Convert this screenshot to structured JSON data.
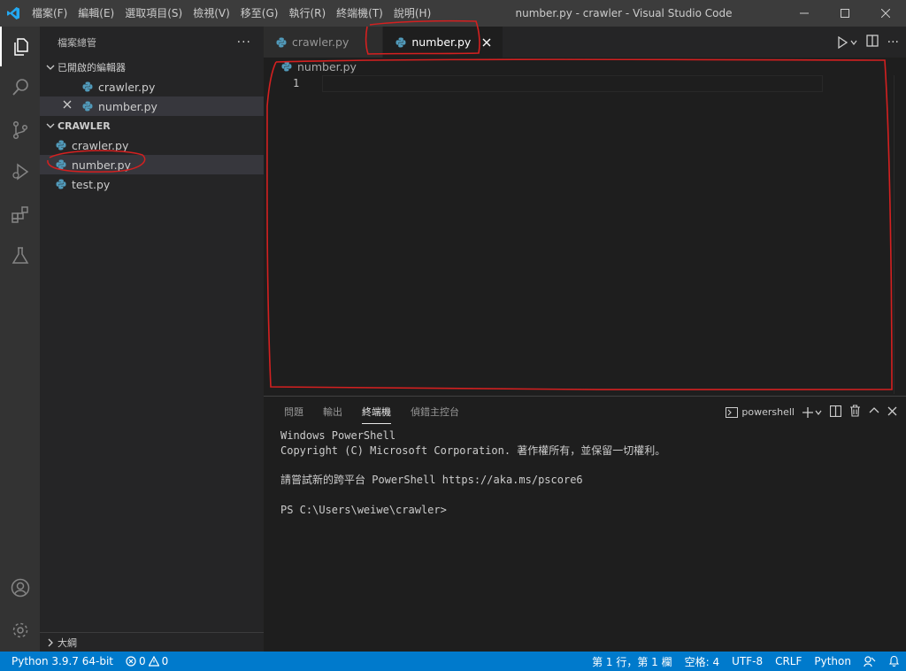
{
  "window": {
    "title": "number.py - crawler - Visual Studio Code"
  },
  "menu": [
    "檔案(F)",
    "編輯(E)",
    "選取項目(S)",
    "檢視(V)",
    "移至(G)",
    "執行(R)",
    "終端機(T)",
    "說明(H)"
  ],
  "sidebar": {
    "title": "檔案總管",
    "open_editors": {
      "header": "已開啟的編輯器",
      "items": [
        {
          "label": "crawler.py"
        },
        {
          "label": "number.py"
        }
      ]
    },
    "folder": {
      "header": "CRAWLER",
      "items": [
        {
          "label": "crawler.py"
        },
        {
          "label": "number.py"
        },
        {
          "label": "test.py"
        }
      ]
    },
    "outline": "大綱"
  },
  "tabs": [
    {
      "label": "crawler.py",
      "active": false
    },
    {
      "label": "number.py",
      "active": true
    }
  ],
  "breadcrumb": "number.py",
  "editor": {
    "line_numbers": [
      "1"
    ]
  },
  "panel": {
    "tabs": [
      "問題",
      "輸出",
      "終端機",
      "偵錯主控台"
    ],
    "active_tab": "終端機",
    "shell": "powershell",
    "terminal_lines": [
      "Windows PowerShell",
      "Copyright (C) Microsoft Corporation. 著作權所有，並保留一切權利。",
      "",
      "請嘗試新的跨平台 PowerShell https://aka.ms/pscore6",
      "",
      "PS C:\\Users\\weiwe\\crawler>"
    ]
  },
  "statusbar": {
    "python": "Python 3.9.7 64-bit",
    "errors": "0",
    "warnings": "0",
    "position": "第 1 行，第 1 欄",
    "spaces": "空格: 4",
    "encoding": "UTF-8",
    "eol": "CRLF",
    "language": "Python"
  },
  "colors": {
    "accent": "#007acc",
    "annotation": "#d42020",
    "python_icon": "#519aba"
  }
}
